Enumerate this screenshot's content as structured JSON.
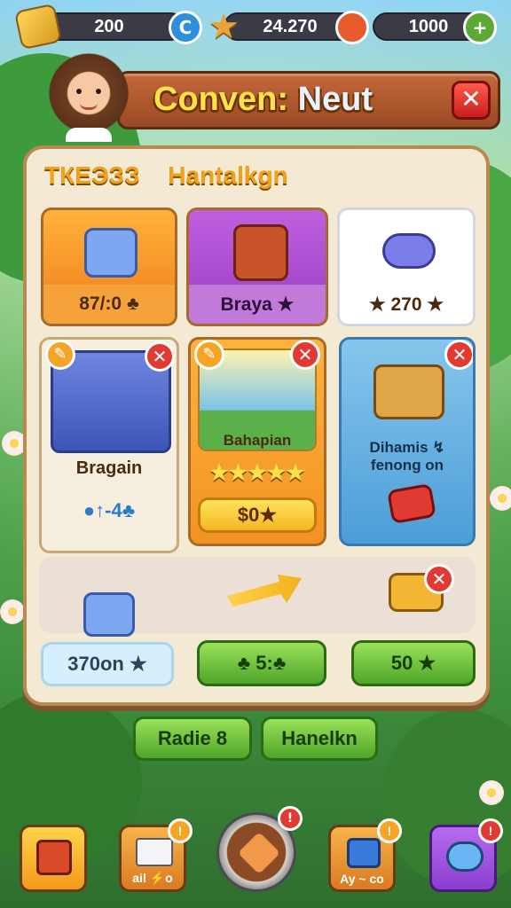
{
  "topbar": {
    "coins": "200",
    "stars": "24.270",
    "gems": "1000",
    "add_glyph": "+",
    "coin_glyph": "C",
    "star_glyph": "★"
  },
  "header": {
    "title_part1": "Conven:",
    "title_part2": "Neut",
    "close_glyph": "✕"
  },
  "panel": {
    "heading_left": "ТКЕЭЗЗ",
    "heading_right": "Hantalkgn",
    "cards": [
      {
        "label": "",
        "price": "87/:0 ♣",
        "color": "#ee8a25"
      },
      {
        "label": "",
        "price": "Braya ★",
        "color": "#a448c9"
      },
      {
        "label": "",
        "price": "★ 270 ★",
        "color": "#ffffff"
      },
      {
        "label": "Bragain",
        "price": "",
        "extra": "●↑-4♣"
      },
      {
        "label": "Bahapian",
        "stars": "★★★★★",
        "price": "$0★"
      },
      {
        "label": "Dihamis ↯\nfenong on",
        "price": ""
      }
    ],
    "bottom_row": {
      "left_price": "370on ★",
      "middle_price": "♣ 5:♣",
      "right_price": "50 ★"
    }
  },
  "actions": {
    "primary": "Radie 8",
    "secondary": "Hanelkn"
  },
  "nav": {
    "items": [
      {
        "label": "",
        "icon": "gift-box-icon",
        "badge": ""
      },
      {
        "label": "ail ⚡o",
        "icon": "mail-icon",
        "badge": "!"
      },
      {
        "label": "",
        "icon": "home-icon",
        "badge": "!"
      },
      {
        "label": "Ay ~ co",
        "icon": "quest-icon",
        "badge": "!"
      },
      {
        "label": "",
        "icon": "chat-icon",
        "badge": "!"
      }
    ]
  },
  "colors": {
    "accent_orange": "#ee8a25",
    "accent_purple": "#a448c9",
    "accent_green": "#4ea528",
    "danger": "#e03a32"
  }
}
